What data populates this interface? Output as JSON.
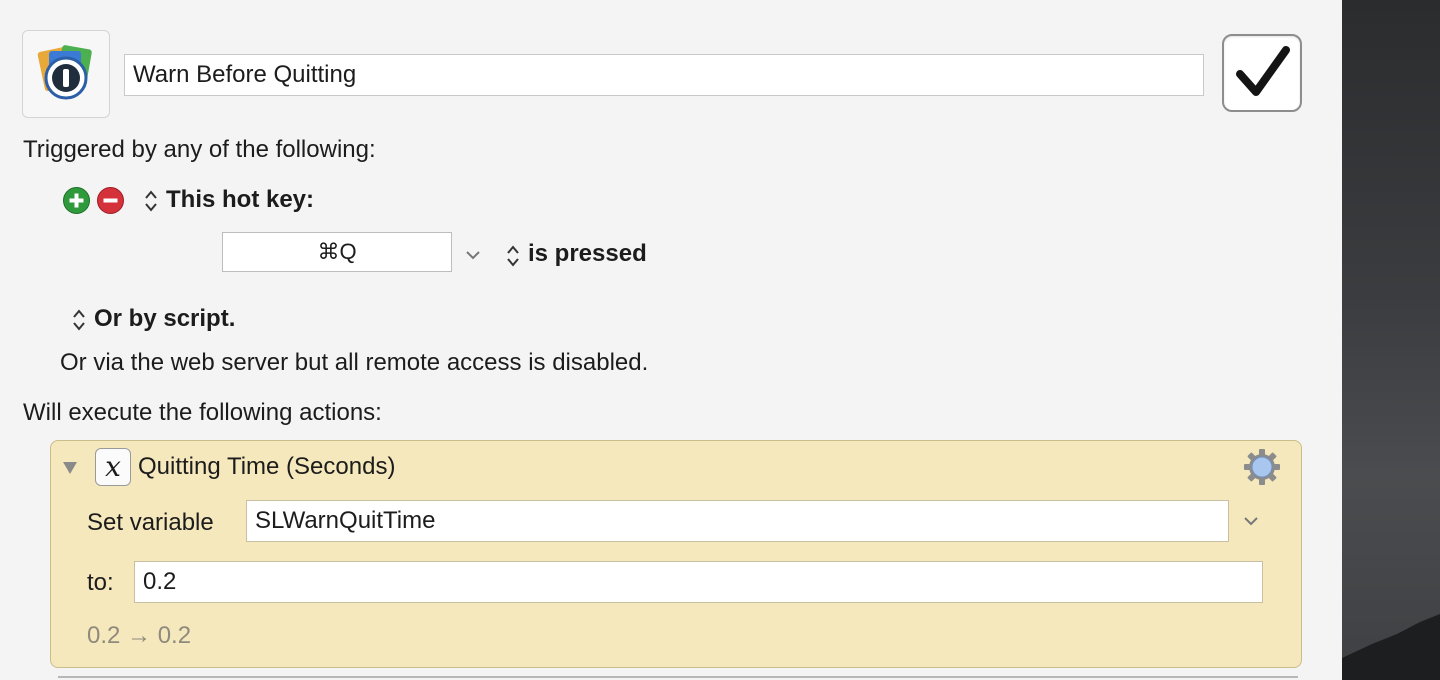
{
  "macro": {
    "name": "Warn Before Quitting",
    "enabled": true,
    "icon": "1password-icon"
  },
  "triggers": {
    "heading": "Triggered by any of the following:",
    "hotkey_label": "This hot key:",
    "hotkey_value": "⌘Q",
    "hotkey_state": "is pressed",
    "script_label": "Or by script.",
    "web_server_note": "Or via the web server but all remote access is disabled."
  },
  "actions": {
    "heading": "Will execute the following actions:",
    "items": [
      {
        "title": "Quitting Time (Seconds)",
        "icon": "variable-icon",
        "set_variable_label": "Set variable",
        "variable_name": "SLWarnQuitTime",
        "to_label": "to:",
        "to_value": "0.2",
        "preview": "0.2 → 0.2"
      }
    ]
  },
  "colors": {
    "action_background": "#f5e8bd",
    "add_button": "#2f9a3b",
    "remove_button": "#d4313b"
  }
}
